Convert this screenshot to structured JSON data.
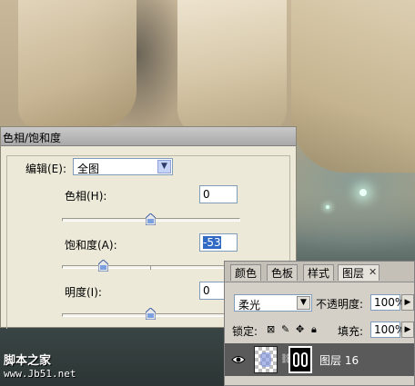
{
  "dialog": {
    "title": "色相/饱和度",
    "edit_label": "编辑(E):",
    "edit_value": "全图",
    "hue_label": "色相(H):",
    "hue_value": "0",
    "saturation_label": "饱和度(A):",
    "saturation_value": "-53",
    "lightness_label": "明度(I):",
    "lightness_value": "0"
  },
  "layers_panel": {
    "tabs": [
      "颜色",
      "色板",
      "样式",
      "图层"
    ],
    "active_tab": "图层",
    "blend_mode": "柔光",
    "opacity_label": "不透明度:",
    "opacity_value": "100%",
    "lock_label": "锁定:",
    "fill_label": "填充:",
    "fill_value": "100%",
    "layer_name": "图层 16"
  },
  "watermark": {
    "line1": "脚本之家",
    "line2": "www.Jb51.net"
  }
}
